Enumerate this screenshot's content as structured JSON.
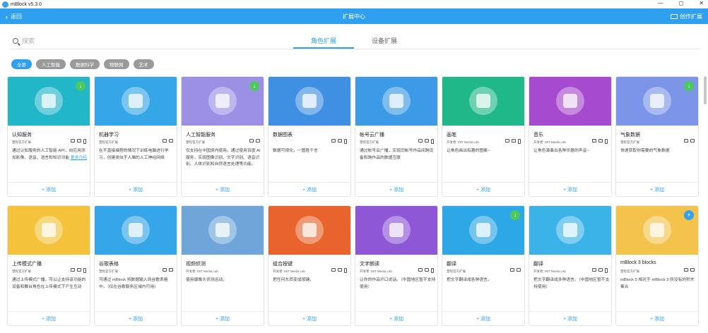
{
  "window": {
    "title": "mBlock v5.3.0",
    "controls": [
      "—",
      "◻",
      "✕"
    ]
  },
  "topbar": {
    "back_label": "返回",
    "title": "扩展中心",
    "create_label": "创作扩展"
  },
  "search": {
    "placeholder": "搜索"
  },
  "tabs": [
    {
      "label": "角色扩展",
      "active": true
    },
    {
      "label": "设备扩展",
      "active": false
    }
  ],
  "filters": [
    {
      "label": "全部",
      "active": true
    },
    {
      "label": "人工智能",
      "active": false
    },
    {
      "label": "数据科学",
      "active": false
    },
    {
      "label": "物联网",
      "active": false
    },
    {
      "label": "艺术",
      "active": false
    }
  ],
  "add_label": "+ 添加",
  "more_label": "更多介绍",
  "cards": [
    {
      "name": "认知服务",
      "meta": "慧程官方扩展",
      "desc": "通过认知服务的人工智能 API，向应用添加影像、语音、语言和知识功能 ",
      "more": true,
      "thumb_color": "#22b6c9",
      "download": true,
      "devices": 3
    },
    {
      "name": "机器学习",
      "meta": "慧程官方扩展",
      "desc": "在不直接编程的情况下训练电脑进行学习，创建类似于人脑的人工神经网络",
      "thumb_color": "#35a7e8",
      "devices": 2
    },
    {
      "name": "人工智能服务",
      "meta": "慧程官方扩展",
      "desc": "仅支持在中国境内使用。通过使用百度 AI 服务，实现图像识别、文字识别、语音识别、人体识别和自然语言处理等功能。",
      "thumb_color": "#9b8fe6",
      "download": true,
      "devices": 2
    },
    {
      "name": "数据图表",
      "meta": "",
      "desc": "数据可视化，一图胜千言",
      "thumb_color": "#3f8fe3",
      "devices": 3
    },
    {
      "name": "帐号云广播",
      "meta": "慧程官方扩展",
      "desc": "通过帐号云广播，实现同帐号作品间跨设备和跨作品的数据互联",
      "thumb_color": "#3c9ae6",
      "devices": 3
    },
    {
      "name": "画笔",
      "meta": "开发者: MIT Media Lab",
      "desc": "让角色画出有趣的图案~",
      "thumb_color": "#21b889",
      "devices": 3
    },
    {
      "name": "音乐",
      "meta": "开发者: MIT Media Lab",
      "desc": "让角色演奏出各种乐器的声音~",
      "thumb_color": "#a64bd0",
      "devices": 3
    },
    {
      "name": "气象数据",
      "meta": "慧程官方扩展",
      "desc": "快速获取你需要的气象数据",
      "thumb_color": "#7c95e8",
      "download": true,
      "devices": 2
    },
    {
      "name": "上传模式广播",
      "meta": "慧程官方扩展",
      "desc": "通过上传模式广播，可以让支持该功能的设备和舞台角色在上传模式下产生互动",
      "thumb_color": "#f5c33b",
      "devices": 3
    },
    {
      "name": "谷歌表格",
      "meta": "慧程官方扩展",
      "desc": "可通过 mBlock 将数据输入到谷歌表格中。（仅在谷歌服务区域内可用）",
      "thumb_color": "#35a7e8",
      "devices": 2
    },
    {
      "name": "视频侦测",
      "meta": "开发者: MIT Media Lab",
      "desc": "使用摄像头侦测运动。",
      "thumb_color": "#6fa6d9",
      "devices": 0
    },
    {
      "name": "组合按键",
      "meta": "开发者: MIT Media Lab",
      "desc": "把任何东西变成按键。",
      "thumb_color": "#e8642c",
      "devices": 3
    },
    {
      "name": "文字朗读",
      "meta": "开发者: MIT Media Lab",
      "desc": "让你的作品开口说话。（中国地区暂不支持使用）",
      "thumb_color": "#8d57d6",
      "devices": 3
    },
    {
      "name": "翻译",
      "meta": "慧程官方扩展",
      "desc": "把文字翻译成各种语言。",
      "thumb_color": "#2da7e6",
      "download": true,
      "devices": 2
    },
    {
      "name": "翻译",
      "meta": "开发者: MIT Media Lab",
      "desc": "把文字翻译成多种语言。（中国地区暂不支持使用）",
      "thumb_color": "#3bb2e8",
      "devices": 3
    },
    {
      "name": "mBlock 3 blocks",
      "meta": "慧程官方扩展",
      "desc": "mBlock 5 相对于 mBlock 3 所没有的积木集合",
      "thumb_color": "#f4c34c",
      "download_blue": true,
      "devices": 2
    }
  ]
}
